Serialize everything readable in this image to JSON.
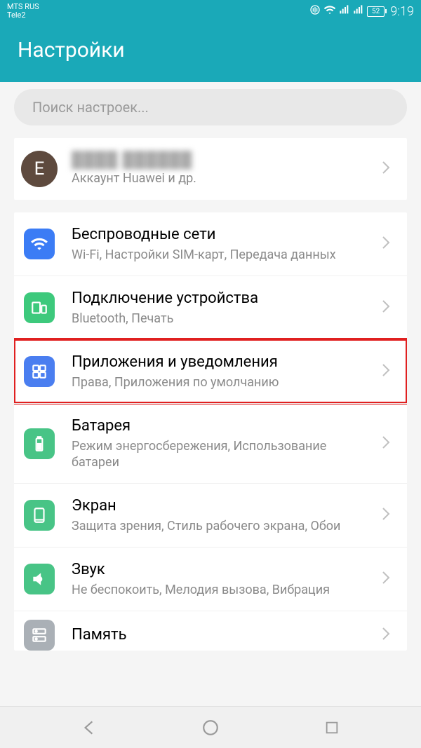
{
  "statusBar": {
    "carrier1": "MTS RUS",
    "carrier2": "Tele2",
    "battery": "52",
    "time": "9:19"
  },
  "title": "Настройки",
  "search": {
    "placeholder": "Поиск настроек..."
  },
  "account": {
    "avatarLetter": "E",
    "subtitle": "Аккаунт Huawei и др."
  },
  "items": [
    {
      "title": "Беспроводные сети",
      "sub": "Wi-Fi, Настройки SIM-карт, Передача данных"
    },
    {
      "title": "Подключение устройства",
      "sub": "Bluetooth, Печать"
    },
    {
      "title": "Приложения и уведомления",
      "sub": "Права, Приложения по умолчанию"
    },
    {
      "title": "Батарея",
      "sub": "Режим энергосбережения, Использование батареи"
    },
    {
      "title": "Экран",
      "sub": "Защита зрения, Стиль рабочего экрана, Обои"
    },
    {
      "title": "Звук",
      "sub": "Не беспокоить, Мелодия вызова, Вибрация"
    },
    {
      "title": "Память",
      "sub": ""
    }
  ]
}
